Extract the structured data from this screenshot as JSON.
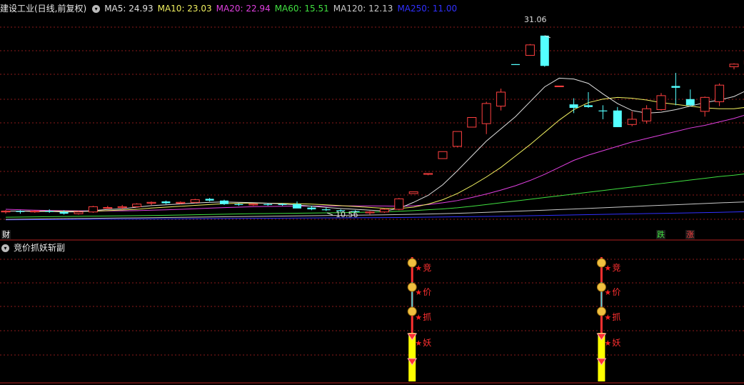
{
  "main_header": {
    "title": "建设工业(日线,前复权)",
    "ma": [
      {
        "label": "MA5: 24.93",
        "color": "#e0e0e0"
      },
      {
        "label": "MA10: 23.03",
        "color": "#f0f060"
      },
      {
        "label": "MA20: 22.94",
        "color": "#e040e0"
      },
      {
        "label": "MA60: 15.51",
        "color": "#40e040"
      },
      {
        "label": "MA120: 12.13",
        "color": "#c8c8c8"
      },
      {
        "label": "MA250: 11.00",
        "color": "#3030ff"
      }
    ]
  },
  "price_labels": {
    "high": "31.06",
    "low": "10.56"
  },
  "markers": {
    "cai": "财",
    "die": "跌",
    "zhang": "涨"
  },
  "sub_header": {
    "title": "竞价抓妖斩副"
  },
  "signal_labels": [
    "竞",
    "价",
    "抓",
    "妖"
  ],
  "colors": {
    "up": "#ff4040",
    "down": "#54ffff",
    "grid": "#8b1a1a",
    "ma5": "#e0e0e0",
    "ma10": "#f0f060",
    "ma20": "#e040e0",
    "ma60": "#40e040",
    "ma120": "#c8c8c8",
    "ma250": "#3030ff",
    "signal_bar": "#ffff00"
  },
  "chart_data": {
    "type": "candlestick",
    "symbol": "建设工业",
    "ohlc": [
      [
        10.9,
        11.1,
        10.7,
        11.0
      ],
      [
        11.0,
        11.1,
        10.7,
        10.9
      ],
      [
        10.9,
        11.1,
        10.8,
        11.0
      ],
      [
        11.0,
        11.2,
        10.8,
        10.9
      ],
      [
        10.9,
        11.1,
        10.6,
        10.7
      ],
      [
        10.7,
        11.0,
        10.6,
        10.9
      ],
      [
        10.9,
        11.6,
        10.8,
        11.5
      ],
      [
        11.4,
        11.6,
        11.3,
        11.4
      ],
      [
        11.4,
        11.7,
        11.2,
        11.5
      ],
      [
        11.5,
        11.9,
        11.4,
        11.8
      ],
      [
        11.9,
        12.1,
        11.7,
        12.0
      ],
      [
        12.1,
        12.2,
        11.8,
        11.9
      ],
      [
        11.9,
        12.1,
        11.8,
        12.0
      ],
      [
        12.0,
        12.4,
        11.9,
        12.3
      ],
      [
        12.4,
        12.5,
        12.1,
        12.2
      ],
      [
        12.2,
        12.3,
        11.7,
        11.8
      ],
      [
        11.8,
        11.9,
        11.6,
        11.7
      ],
      [
        11.7,
        11.9,
        11.6,
        11.8
      ],
      [
        11.8,
        11.9,
        11.6,
        11.7
      ],
      [
        11.8,
        11.9,
        11.6,
        11.7
      ],
      [
        11.8,
        12.1,
        11.6,
        11.3
      ],
      [
        11.4,
        11.6,
        11.1,
        11.2
      ],
      [
        11.2,
        11.4,
        11.0,
        11.1
      ],
      [
        11.1,
        11.2,
        10.9,
        11.0
      ],
      [
        11.0,
        11.1,
        10.8,
        10.9
      ],
      [
        10.8,
        11.0,
        10.56,
        10.9
      ],
      [
        10.9,
        11.3,
        10.8,
        11.2
      ],
      [
        11.2,
        12.5,
        11.1,
        12.4
      ],
      [
        13.0,
        13.2,
        13.0,
        13.2
      ],
      [
        15.2,
        15.3,
        15.1,
        15.3
      ],
      [
        17.0,
        17.8,
        17.0,
        17.8
      ],
      [
        18.4,
        20.0,
        18.3,
        20.1
      ],
      [
        20.6,
        21.7,
        20.6,
        21.7
      ],
      [
        21.0,
        23.5,
        19.8,
        23.3
      ],
      [
        23.0,
        25.0,
        22.5,
        24.6
      ],
      [
        27.8,
        27.8,
        27.7,
        27.7
      ],
      [
        28.8,
        30.1,
        28.8,
        30.0
      ],
      [
        31.06,
        31.06,
        27.5,
        27.6
      ],
      [
        25.3,
        25.3,
        25.3,
        25.3
      ],
      [
        23.2,
        23.9,
        22.2,
        22.8
      ],
      [
        23.1,
        24.6,
        22.8,
        22.9
      ],
      [
        22.5,
        23.1,
        21.5,
        22.4
      ],
      [
        22.5,
        22.9,
        20.6,
        20.6
      ],
      [
        20.9,
        22.4,
        20.7,
        21.5
      ],
      [
        21.3,
        23.1,
        21.0,
        22.7
      ],
      [
        22.6,
        24.5,
        22.5,
        24.2
      ],
      [
        25.3,
        26.8,
        23.1,
        25.1
      ],
      [
        23.8,
        24.9,
        23.0,
        23.1
      ],
      [
        22.4,
        24.1,
        21.8,
        24.0
      ],
      [
        23.5,
        25.6,
        23.0,
        25.4
      ],
      [
        27.5,
        27.9,
        27.2,
        27.8
      ],
      [
        27.8,
        28.5,
        26.8,
        28.2
      ],
      [
        28.1,
        30.5,
        27.8,
        30.0
      ]
    ],
    "ma5": [
      11.0,
      11.0,
      10.95,
      10.97,
      10.9,
      10.92,
      11.06,
      11.18,
      11.26,
      11.45,
      11.62,
      11.72,
      11.82,
      11.92,
      12.0,
      12.04,
      12.0,
      11.96,
      11.9,
      11.82,
      11.7,
      11.56,
      11.42,
      11.3,
      11.2,
      11.1,
      11.02,
      11.3,
      12.0,
      12.8,
      14.0,
      15.6,
      17.3,
      19.0,
      20.4,
      21.8,
      23.5,
      25.2,
      26.2,
      26.1,
      25.6,
      24.4,
      23.3,
      22.5,
      22.2,
      22.3,
      22.6,
      23.0,
      23.4,
      23.7,
      24.1,
      24.9,
      26.0
    ],
    "ma10": [
      11.0,
      11.0,
      11.0,
      11.0,
      10.98,
      10.97,
      10.98,
      11.05,
      11.12,
      11.2,
      11.35,
      11.45,
      11.55,
      11.65,
      11.75,
      11.85,
      11.9,
      11.92,
      11.9,
      11.88,
      11.85,
      11.8,
      11.72,
      11.62,
      11.52,
      11.42,
      11.32,
      11.3,
      11.45,
      11.8,
      12.3,
      13.0,
      13.9,
      14.9,
      16.0,
      17.3,
      18.6,
      20.0,
      21.4,
      22.6,
      23.4,
      23.8,
      24.0,
      23.9,
      23.7,
      23.4,
      23.2,
      23.0,
      22.8,
      22.7,
      22.7,
      22.9,
      23.4
    ],
    "ma20": [
      11.2,
      11.15,
      11.1,
      11.07,
      11.05,
      11.03,
      11.02,
      11.02,
      11.03,
      11.05,
      11.1,
      11.14,
      11.2,
      11.27,
      11.34,
      11.4,
      11.45,
      11.5,
      11.53,
      11.55,
      11.56,
      11.57,
      11.58,
      11.59,
      11.59,
      11.59,
      11.58,
      11.55,
      11.6,
      11.75,
      11.95,
      12.2,
      12.55,
      12.95,
      13.4,
      13.9,
      14.5,
      15.2,
      16.0,
      16.8,
      17.4,
      17.9,
      18.4,
      18.9,
      19.3,
      19.7,
      20.1,
      20.5,
      20.8,
      21.2,
      21.6,
      22.1,
      22.9
    ],
    "ma60": [
      10.3,
      10.32,
      10.34,
      10.36,
      10.38,
      10.4,
      10.42,
      10.44,
      10.46,
      10.48,
      10.5,
      10.52,
      10.55,
      10.58,
      10.61,
      10.64,
      10.67,
      10.7,
      10.72,
      10.74,
      10.76,
      10.78,
      10.8,
      10.82,
      10.85,
      10.88,
      10.92,
      10.98,
      11.05,
      11.15,
      11.25,
      11.38,
      11.55,
      11.75,
      11.95,
      12.15,
      12.35,
      12.55,
      12.75,
      12.95,
      13.15,
      13.35,
      13.55,
      13.75,
      13.95,
      14.15,
      14.35,
      14.55,
      14.75,
      14.95,
      15.1,
      15.3,
      15.51
    ],
    "ma120": [
      10.05,
      10.07,
      10.09,
      10.11,
      10.13,
      10.15,
      10.17,
      10.19,
      10.21,
      10.23,
      10.25,
      10.27,
      10.29,
      10.31,
      10.33,
      10.35,
      10.37,
      10.39,
      10.41,
      10.43,
      10.45,
      10.47,
      10.49,
      10.51,
      10.53,
      10.55,
      10.57,
      10.6,
      10.63,
      10.66,
      10.7,
      10.75,
      10.8,
      10.86,
      10.92,
      10.98,
      11.04,
      11.1,
      11.17,
      11.24,
      11.31,
      11.38,
      11.45,
      11.52,
      11.59,
      11.66,
      11.73,
      11.8,
      11.87,
      11.94,
      12.0,
      12.06,
      12.13
    ],
    "ma250": [
      10.0,
      10.01,
      10.02,
      10.03,
      10.04,
      10.05,
      10.06,
      10.07,
      10.08,
      10.09,
      10.1,
      10.11,
      10.12,
      10.13,
      10.14,
      10.15,
      10.16,
      10.17,
      10.18,
      10.19,
      10.2,
      10.21,
      10.22,
      10.23,
      10.24,
      10.25,
      10.26,
      10.27,
      10.29,
      10.31,
      10.33,
      10.35,
      10.37,
      10.39,
      10.41,
      10.44,
      10.47,
      10.5,
      10.53,
      10.56,
      10.59,
      10.62,
      10.65,
      10.68,
      10.71,
      10.74,
      10.77,
      10.8,
      10.83,
      10.86,
      10.9,
      10.95,
      11.0
    ],
    "signals": [
      28,
      41
    ],
    "y_range": [
      9.0,
      33.5
    ]
  }
}
